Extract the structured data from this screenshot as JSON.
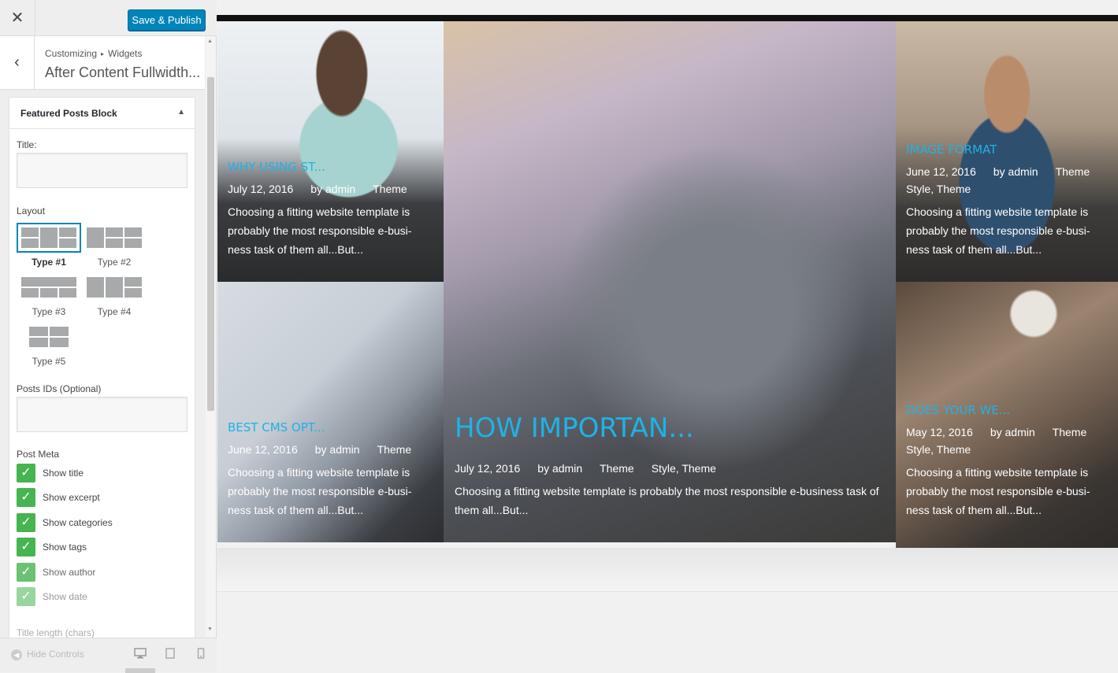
{
  "topbar": {
    "close_icon": "close-icon",
    "publish_label": "Save & Publish",
    "publish_color": "#0085ba"
  },
  "section": {
    "breadcrumb_parent": "Customizing",
    "breadcrumb_child": "Widgets",
    "title": "After Content Fullwidth..."
  },
  "widget": {
    "title": "Featured Posts Block",
    "title_label": "Title:",
    "title_value": "",
    "layout_label": "Layout",
    "layouts": [
      "Type #1",
      "Type #2",
      "Type #3",
      "Type #4",
      "Type #5"
    ],
    "selected_layout": "Type #1",
    "post_ids_label": "Posts IDs (Optional)",
    "post_ids_value": "",
    "post_meta_label": "Post Meta",
    "meta_options": [
      {
        "label": "Show title",
        "checked": true
      },
      {
        "label": "Show excerpt",
        "checked": true
      },
      {
        "label": "Show categories",
        "checked": true
      },
      {
        "label": "Show tags",
        "checked": true
      },
      {
        "label": "Show author",
        "checked": true
      },
      {
        "label": "Show date",
        "checked": true
      }
    ],
    "title_length_label": "Title length (chars)"
  },
  "footer": {
    "hide_controls": "Hide Controls",
    "devices": [
      "desktop-icon",
      "tablet-icon",
      "mobile-icon"
    ]
  },
  "posts": [
    {
      "title": "WHY USING ST...",
      "date": "July 12, 2016",
      "author": "by admin",
      "categories": "Theme",
      "excerpt": "Choosing a fitting website template is probably the most responsible e-busi-ness task of them all...But..."
    },
    {
      "title": "BEST CMS OPT...",
      "date": "June 12, 2016",
      "author": "by admin",
      "categories": "Theme",
      "excerpt": "Choosing a fitting website template is probably the most responsible e-busi-ness task of them all...But..."
    },
    {
      "title": "HOW IMPORTAN...",
      "date": "July 12, 2016",
      "author": "by admin",
      "categories": "Theme",
      "tags": "Style, Theme",
      "excerpt": "Choosing a fitting website template is probably the most responsible e-business task of them all...But..."
    },
    {
      "title": "IMAGE FORMAT",
      "date": "June 12, 2016",
      "author": "by admin",
      "categories": "Theme",
      "tags": "Style, Theme",
      "excerpt": "Choosing a fitting website template is probably the most responsible e-busi-ness task of them all...But..."
    },
    {
      "title": "DOES YOUR WE...",
      "date": "May 12, 2016",
      "author": "by admin",
      "categories": "Theme",
      "tags": "Style, Theme",
      "excerpt": "Choosing a fitting website template is probably the most responsible e-busi-ness task of them all...But..."
    }
  ],
  "colors": {
    "accent_title": "#1fb2e6",
    "checkbox": "#46b450"
  }
}
